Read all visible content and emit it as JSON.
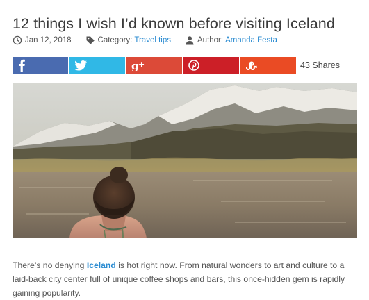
{
  "article": {
    "title": "12 things I wish I’d known before visiting Iceland",
    "date": "Jan 12, 2018",
    "category_label": "Category:",
    "category": "Travel tips",
    "author_label": "Author:",
    "author": "Amanda Festa"
  },
  "share": {
    "buttons": [
      {
        "network": "facebook",
        "icon": "facebook-icon",
        "color": "#4a6bb0"
      },
      {
        "network": "twitter",
        "icon": "twitter-icon",
        "color": "#30b8e6"
      },
      {
        "network": "google-plus",
        "icon": "google-plus-icon",
        "color": "#dc4a38"
      },
      {
        "network": "pinterest",
        "icon": "pinterest-icon",
        "color": "#cc1f27"
      },
      {
        "network": "stumbleupon",
        "icon": "stumbleupon-icon",
        "color": "#ea4b24"
      }
    ],
    "count": "43 Shares"
  },
  "hero": {
    "icon": "hot-spring-photo"
  },
  "body": {
    "intro_before": "There’s no denying ",
    "intro_link": "Iceland",
    "intro_after": " is hot right now. From natural wonders to art and culture to a laid-back city center full of unique coffee shops and bars, this once-hidden gem is rapidly gaining popularity."
  },
  "colors": {
    "link": "#2a8bd1",
    "title": "#3a3a3a"
  }
}
